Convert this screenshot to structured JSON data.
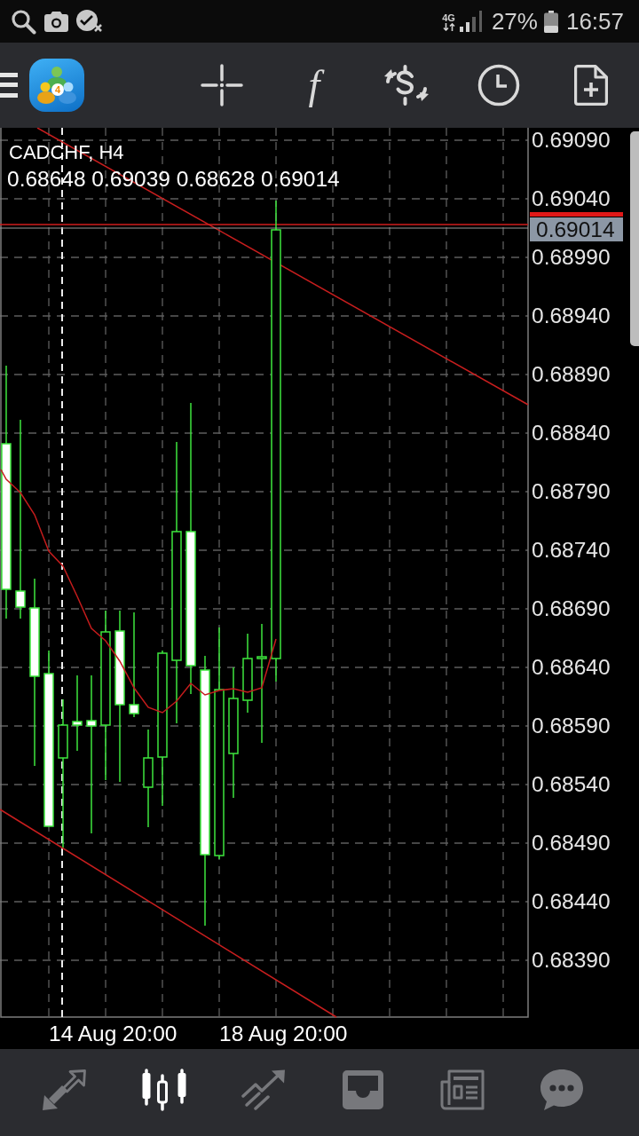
{
  "status_bar": {
    "network": "4G",
    "battery": "27%",
    "time": "16:57"
  },
  "toolbar": {
    "logo_badge": "4",
    "function_button": "f"
  },
  "chart": {
    "symbol": "CADCHF, H4",
    "ohlc": "0.68648 0.69039 0.68628 0.69014",
    "price_labels": [
      "0.69090",
      "0.69040",
      "0.68990",
      "0.68940",
      "0.68890",
      "0.68840",
      "0.68790",
      "0.68740",
      "0.68690",
      "0.68640",
      "0.68590",
      "0.68540",
      "0.68490",
      "0.68440",
      "0.68390"
    ],
    "current_price": "0.69014",
    "time_labels": [
      "14 Aug 20:00",
      "18 Aug 20:00"
    ]
  },
  "bottom_nav": [
    {
      "selected": false
    },
    {
      "selected": true
    },
    {
      "selected": false
    },
    {
      "selected": false
    },
    {
      "selected": false
    },
    {
      "selected": false
    }
  ]
}
